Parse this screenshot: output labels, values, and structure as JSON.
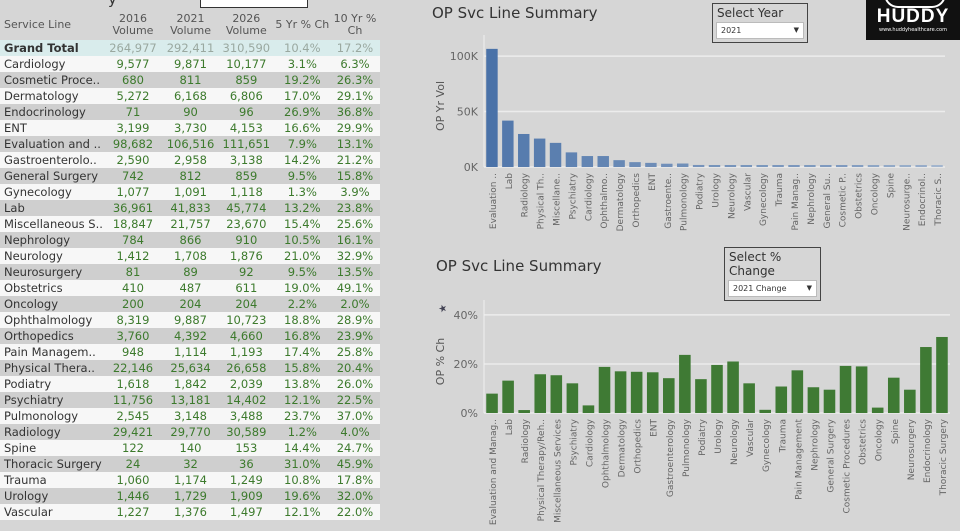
{
  "table": {
    "headers": [
      "Service Line",
      "2016 Volume",
      "2021 Volume",
      "2026 Volume",
      "5 Yr % Ch",
      "10 Yr % Ch"
    ],
    "total": {
      "name": "Grand Total",
      "v2016": "264,977",
      "v2021": "292,411",
      "v2026": "310,590",
      "ch5": "10.4%",
      "ch10": "17.2%"
    },
    "rows": [
      {
        "name": "Cardiology",
        "v2016": "9,577",
        "v2021": "9,871",
        "v2026": "10,177",
        "ch5": "3.1%",
        "ch10": "6.3%"
      },
      {
        "name": "Cosmetic Proce..",
        "v2016": "680",
        "v2021": "811",
        "v2026": "859",
        "ch5": "19.2%",
        "ch10": "26.3%"
      },
      {
        "name": "Dermatology",
        "v2016": "5,272",
        "v2021": "6,168",
        "v2026": "6,806",
        "ch5": "17.0%",
        "ch10": "29.1%"
      },
      {
        "name": "Endocrinology",
        "v2016": "71",
        "v2021": "90",
        "v2026": "96",
        "ch5": "26.9%",
        "ch10": "36.8%"
      },
      {
        "name": "ENT",
        "v2016": "3,199",
        "v2021": "3,730",
        "v2026": "4,153",
        "ch5": "16.6%",
        "ch10": "29.9%"
      },
      {
        "name": "Evaluation and ..",
        "v2016": "98,682",
        "v2021": "106,516",
        "v2026": "111,651",
        "ch5": "7.9%",
        "ch10": "13.1%"
      },
      {
        "name": "Gastroenterolo..",
        "v2016": "2,590",
        "v2021": "2,958",
        "v2026": "3,138",
        "ch5": "14.2%",
        "ch10": "21.2%"
      },
      {
        "name": "General Surgery",
        "v2016": "742",
        "v2021": "812",
        "v2026": "859",
        "ch5": "9.5%",
        "ch10": "15.8%"
      },
      {
        "name": "Gynecology",
        "v2016": "1,077",
        "v2021": "1,091",
        "v2026": "1,118",
        "ch5": "1.3%",
        "ch10": "3.9%"
      },
      {
        "name": "Lab",
        "v2016": "36,961",
        "v2021": "41,833",
        "v2026": "45,774",
        "ch5": "13.2%",
        "ch10": "23.8%"
      },
      {
        "name": "Miscellaneous S..",
        "v2016": "18,847",
        "v2021": "21,757",
        "v2026": "23,670",
        "ch5": "15.4%",
        "ch10": "25.6%"
      },
      {
        "name": "Nephrology",
        "v2016": "784",
        "v2021": "866",
        "v2026": "910",
        "ch5": "10.5%",
        "ch10": "16.1%"
      },
      {
        "name": "Neurology",
        "v2016": "1,412",
        "v2021": "1,708",
        "v2026": "1,876",
        "ch5": "21.0%",
        "ch10": "32.9%"
      },
      {
        "name": "Neurosurgery",
        "v2016": "81",
        "v2021": "89",
        "v2026": "92",
        "ch5": "9.5%",
        "ch10": "13.5%"
      },
      {
        "name": "Obstetrics",
        "v2016": "410",
        "v2021": "487",
        "v2026": "611",
        "ch5": "19.0%",
        "ch10": "49.1%"
      },
      {
        "name": "Oncology",
        "v2016": "200",
        "v2021": "204",
        "v2026": "204",
        "ch5": "2.2%",
        "ch10": "2.0%"
      },
      {
        "name": "Ophthalmology",
        "v2016": "8,319",
        "v2021": "9,887",
        "v2026": "10,723",
        "ch5": "18.8%",
        "ch10": "28.9%"
      },
      {
        "name": "Orthopedics",
        "v2016": "3,760",
        "v2021": "4,392",
        "v2026": "4,660",
        "ch5": "16.8%",
        "ch10": "23.9%"
      },
      {
        "name": "Pain Managem..",
        "v2016": "948",
        "v2021": "1,114",
        "v2026": "1,193",
        "ch5": "17.4%",
        "ch10": "25.8%"
      },
      {
        "name": "Physical Thera..",
        "v2016": "22,146",
        "v2021": "25,634",
        "v2026": "26,658",
        "ch5": "15.8%",
        "ch10": "20.4%"
      },
      {
        "name": "Podiatry",
        "v2016": "1,618",
        "v2021": "1,842",
        "v2026": "2,039",
        "ch5": "13.8%",
        "ch10": "26.0%"
      },
      {
        "name": "Psychiatry",
        "v2016": "11,756",
        "v2021": "13,181",
        "v2026": "14,402",
        "ch5": "12.1%",
        "ch10": "22.5%"
      },
      {
        "name": "Pulmonology",
        "v2016": "2,545",
        "v2021": "3,148",
        "v2026": "3,488",
        "ch5": "23.7%",
        "ch10": "37.0%"
      },
      {
        "name": "Radiology",
        "v2016": "29,421",
        "v2021": "29,770",
        "v2026": "30,589",
        "ch5": "1.2%",
        "ch10": "4.0%"
      },
      {
        "name": "Spine",
        "v2016": "122",
        "v2021": "140",
        "v2026": "153",
        "ch5": "14.4%",
        "ch10": "24.7%"
      },
      {
        "name": "Thoracic Surgery",
        "v2016": "24",
        "v2021": "32",
        "v2026": "36",
        "ch5": "31.0%",
        "ch10": "45.9%"
      },
      {
        "name": "Trauma",
        "v2016": "1,060",
        "v2021": "1,174",
        "v2026": "1,249",
        "ch5": "10.8%",
        "ch10": "17.8%"
      },
      {
        "name": "Urology",
        "v2016": "1,446",
        "v2021": "1,729",
        "v2026": "1,909",
        "ch5": "19.6%",
        "ch10": "32.0%"
      },
      {
        "name": "Vascular",
        "v2016": "1,227",
        "v2021": "1,376",
        "v2026": "1,497",
        "ch5": "12.1%",
        "ch10": "22.0%"
      }
    ]
  },
  "top_param": {
    "label": "Select Year",
    "value": "2021"
  },
  "bottom_param": {
    "label": "Select % Change",
    "value": "2021 Change"
  },
  "logo": {
    "name": "HUDDY",
    "url_text": "www.huddyhealthcare.com"
  },
  "colors": {
    "volume_bar": "#4a72a8",
    "change_bar": "#3f7a34",
    "number_text": "#3c7a2c"
  },
  "chart_data": [
    {
      "type": "bar",
      "title": "OP Svc Line Summary",
      "xlabel": "",
      "ylabel": "OP Yr Vol",
      "ylim": [
        0,
        110000
      ],
      "yticks": [
        0,
        50000,
        100000
      ],
      "ytick_labels": [
        "0K",
        "50K",
        "100K"
      ],
      "grid": true,
      "categories": [
        "Evaluation ..",
        "Lab",
        "Radiology",
        "Physical Th..",
        "Miscellane..",
        "Psychiatry",
        "Cardiology",
        "Ophthalmo..",
        "Dermatology",
        "Orthopedics",
        "ENT",
        "Gastroente..",
        "Pulmonology",
        "Podiatry",
        "Urology",
        "Neurology",
        "Vascular",
        "Gynecology",
        "Trauma",
        "Pain Manag..",
        "Nephrology",
        "General Su..",
        "Cosmetic P..",
        "Obstetrics",
        "Oncology",
        "Spine",
        "Neurosurge..",
        "Endocrinol..",
        "Thoracic S.."
      ],
      "values": [
        106516,
        41833,
        29770,
        25634,
        21757,
        13181,
        9871,
        9887,
        6168,
        4392,
        3730,
        2958,
        3148,
        1842,
        1729,
        1708,
        1376,
        1091,
        1174,
        1114,
        866,
        812,
        811,
        487,
        204,
        140,
        89,
        90,
        32
      ]
    },
    {
      "type": "bar",
      "title": "OP Svc Line Summary",
      "xlabel": "",
      "ylabel": "OP % Ch",
      "ylim": [
        0,
        42
      ],
      "yticks": [
        0,
        20,
        40
      ],
      "ytick_labels": [
        "0%",
        "20%",
        "40%"
      ],
      "grid": true,
      "categories": [
        "Evaluation and Manag..",
        "Lab",
        "Radiology",
        "Physical Therapy/Reh..",
        "Miscellaneous Services",
        "Psychiatry",
        "Cardiology",
        "Ophthalmology",
        "Dermatology",
        "Orthopedics",
        "ENT",
        "Gastroenterology",
        "Pulmonology",
        "Podiatry",
        "Urology",
        "Neurology",
        "Vascular",
        "Gynecology",
        "Trauma",
        "Pain Management",
        "Nephrology",
        "General Surgery",
        "Cosmetic Procedures",
        "Obstetrics",
        "Oncology",
        "Spine",
        "Neurosurgery",
        "Endocrinology",
        "Thoracic Surgery"
      ],
      "values": [
        7.9,
        13.2,
        1.2,
        15.8,
        15.4,
        12.1,
        3.1,
        18.8,
        17.0,
        16.8,
        16.6,
        14.2,
        23.7,
        13.8,
        19.6,
        21.0,
        12.1,
        1.3,
        10.8,
        17.4,
        10.5,
        9.5,
        19.2,
        19.0,
        2.2,
        14.4,
        9.5,
        26.9,
        31.0
      ]
    }
  ]
}
